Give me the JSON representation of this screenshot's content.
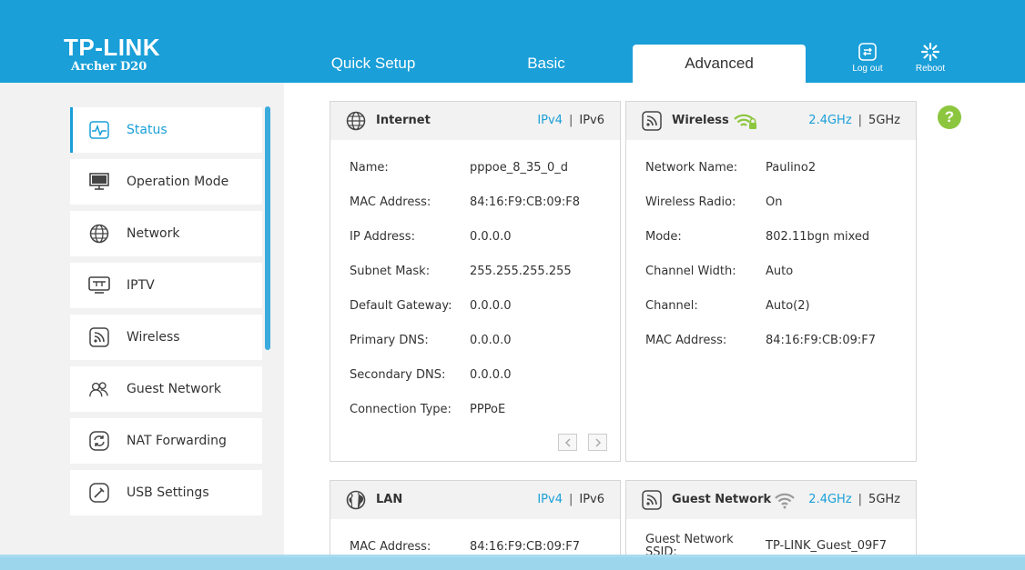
{
  "header": {
    "logo": "TP-LINK",
    "model": "Archer D20",
    "tabs": [
      {
        "label": "Quick Setup"
      },
      {
        "label": "Basic"
      },
      {
        "label": "Advanced"
      }
    ],
    "logout_label": "Log out",
    "reboot_label": "Reboot",
    "brand_color": "#1a9fd8"
  },
  "sidebar": {
    "items": [
      {
        "label": "Status",
        "icon": "status-icon"
      },
      {
        "label": "Operation Mode",
        "icon": "monitor-icon"
      },
      {
        "label": "Network",
        "icon": "globe-icon"
      },
      {
        "label": "IPTV",
        "icon": "tv-icon"
      },
      {
        "label": "Wireless",
        "icon": "wifi-icon"
      },
      {
        "label": "Guest Network",
        "icon": "guest-icon"
      },
      {
        "label": "NAT Forwarding",
        "icon": "refresh-icon"
      },
      {
        "label": "USB Settings",
        "icon": "usb-icon"
      }
    ]
  },
  "internet": {
    "title": "Internet",
    "switch_active": "IPv4",
    "switch_other": "IPv6",
    "rows": [
      {
        "label": "Name:",
        "value": "pppoe_8_35_0_d"
      },
      {
        "label": "MAC Address:",
        "value": "84:16:F9:CB:09:F8"
      },
      {
        "label": "IP Address:",
        "value": "0.0.0.0"
      },
      {
        "label": "Subnet Mask:",
        "value": "255.255.255.255"
      },
      {
        "label": "Default Gateway:",
        "value": "0.0.0.0"
      },
      {
        "label": "Primary DNS:",
        "value": "0.0.0.0"
      },
      {
        "label": "Secondary DNS:",
        "value": "0.0.0.0"
      },
      {
        "label": "Connection Type:",
        "value": "PPPoE"
      }
    ]
  },
  "wireless": {
    "title": "Wireless",
    "switch_active": "2.4GHz",
    "switch_other": "5GHz",
    "rows": [
      {
        "label": "Network Name:",
        "value": "Paulino2"
      },
      {
        "label": "Wireless Radio:",
        "value": "On"
      },
      {
        "label": "Mode:",
        "value": "802.11bgn mixed"
      },
      {
        "label": "Channel Width:",
        "value": "Auto"
      },
      {
        "label": "Channel:",
        "value": "Auto(2)"
      },
      {
        "label": "MAC Address:",
        "value": "84:16:F9:CB:09:F7"
      }
    ]
  },
  "lan": {
    "title": "LAN",
    "switch_active": "IPv4",
    "switch_other": "IPv6",
    "rows": [
      {
        "label": "MAC Address:",
        "value": "84:16:F9:CB:09:F7"
      }
    ]
  },
  "guest": {
    "title": "Guest Network",
    "switch_active": "2.4GHz",
    "switch_other": "5GHz",
    "rows": [
      {
        "label": "Guest Network SSID:",
        "value": "TP-LINK_Guest_09F7"
      }
    ]
  },
  "help_label": "?"
}
